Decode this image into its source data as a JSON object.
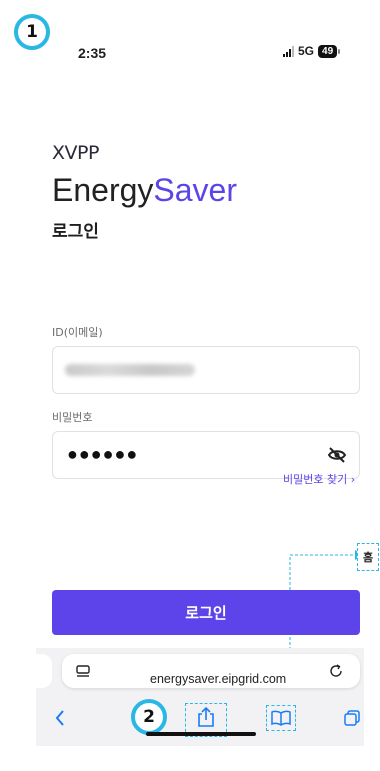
{
  "markers": {
    "step1": "1",
    "step2": "2"
  },
  "status_bar": {
    "time": "2:35",
    "network": "5G",
    "battery": "49"
  },
  "brand": {
    "logo": "XVPP",
    "name_part1": "Energy",
    "name_part2": "Saver",
    "subtitle": "로그인"
  },
  "form": {
    "id_label": "ID(이메일)",
    "password_label": "비밀번호",
    "password_value": "●●●●●●",
    "forgot_link": "비밀번호 찾기",
    "login_button": "로그인"
  },
  "home_tag": "홈",
  "browser": {
    "url": "energysaver.eipgrid.com"
  },
  "colors": {
    "accent": "#5b45e8",
    "button": "#5c44ea",
    "annotation": "#29b7e6"
  }
}
